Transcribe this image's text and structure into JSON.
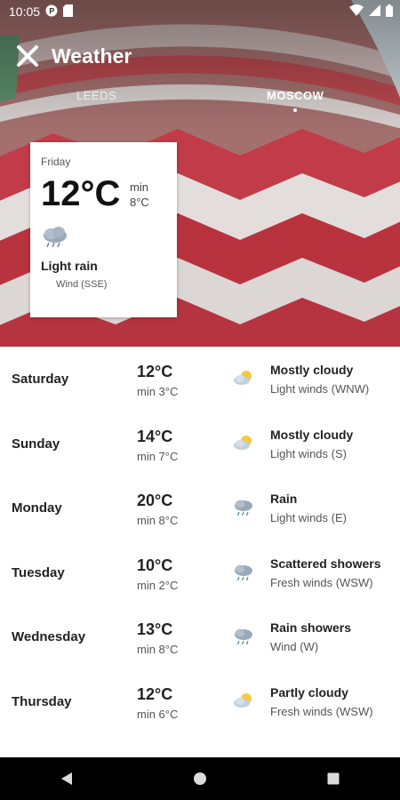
{
  "status_bar": {
    "time": "10:05"
  },
  "app_bar": {
    "title": "Weather"
  },
  "tabs": [
    {
      "label": "LEEDS",
      "active": false
    },
    {
      "label": "MOSCOW",
      "active": true
    }
  ],
  "current": {
    "day": "Friday",
    "temp": "12°C",
    "min_label": "min",
    "min_temp": "8°C",
    "icon": "rain-cloud-icon",
    "condition": "Light rain",
    "wind": "Wind (SSE)"
  },
  "forecast": [
    {
      "day": "Saturday",
      "high": "12°C",
      "low": "min 3°C",
      "icon": "partly-cloudy-icon",
      "condition": "Mostly cloudy",
      "wind": "Light winds (WNW)"
    },
    {
      "day": "Sunday",
      "high": "14°C",
      "low": "min 7°C",
      "icon": "partly-cloudy-icon",
      "condition": "Mostly cloudy",
      "wind": "Light winds (S)"
    },
    {
      "day": "Monday",
      "high": "20°C",
      "low": "min 8°C",
      "icon": "rain-cloud-icon",
      "condition": "Rain",
      "wind": "Light winds (E)"
    },
    {
      "day": "Tuesday",
      "high": "10°C",
      "low": "min 2°C",
      "icon": "rain-cloud-icon",
      "condition": "Scattered showers",
      "wind": "Fresh winds (WSW)"
    },
    {
      "day": "Wednesday",
      "high": "13°C",
      "low": "min 8°C",
      "icon": "rain-cloud-icon",
      "condition": "Rain showers",
      "wind": "Wind (W)"
    },
    {
      "day": "Thursday",
      "high": "12°C",
      "low": "min 6°C",
      "icon": "partly-cloudy-icon",
      "condition": "Partly cloudy",
      "wind": "Fresh winds (WSW)"
    }
  ],
  "colors": {
    "stripe_red": "#c2404c",
    "stripe_white": "#e8e4e2",
    "sun": "#f5c842",
    "cloud_grey": "#9aa9b8"
  }
}
